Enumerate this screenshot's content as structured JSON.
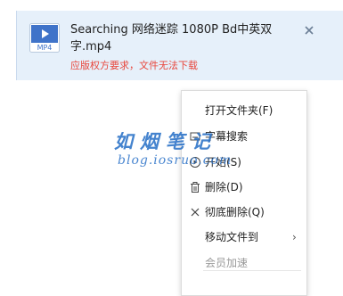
{
  "task": {
    "file_icon_label": "MP4",
    "file_name": "Searching 网络迷踪 1080P Bd中英双字.mp4",
    "warning": "应版权方要求，文件无法下载",
    "close_icon": "close-icon"
  },
  "context_menu": {
    "items": [
      {
        "label": "打开文件夹(F)",
        "icon": "none"
      },
      {
        "label": "字幕搜索",
        "icon": "subtitle-icon"
      },
      {
        "label": "开始(S)",
        "icon": "play-circle-icon"
      },
      {
        "label": "删除(D)",
        "icon": "trash-icon"
      },
      {
        "label": "彻底删除(Q)",
        "icon": "x-icon"
      },
      {
        "label": "移动文件到",
        "icon": "none",
        "submenu_arrow": "›"
      },
      {
        "label": "会员加速",
        "icon": "none",
        "disabled": true
      }
    ]
  },
  "watermark": {
    "title": "如烟笔记",
    "url": "blog.iosruo.com"
  },
  "colors": {
    "card_bg": "#e6f0fa",
    "warning": "#e8463c",
    "file_icon": "#3f73c9",
    "watermark": "#2b72c8"
  }
}
